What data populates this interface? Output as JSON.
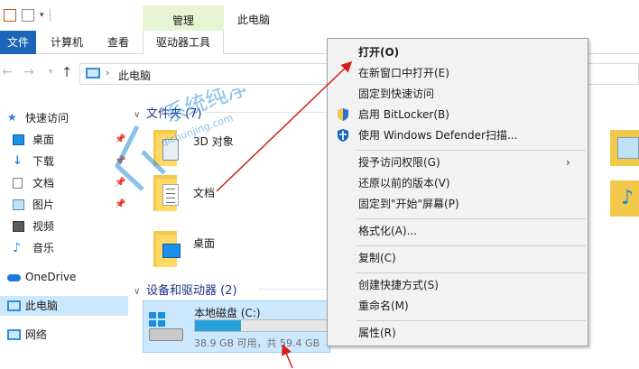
{
  "title_bar": {
    "manage_tab": "管理",
    "window_title": "此电脑"
  },
  "ribbon": {
    "tabs": [
      "文件",
      "计算机",
      "查看",
      "驱动器工具"
    ]
  },
  "address_bar": {
    "separator": "›",
    "path": "此电脑"
  },
  "nav_pane": {
    "quick_access": "快速访问",
    "items": [
      "桌面",
      "下载",
      "文档",
      "图片",
      "视频",
      "音乐"
    ],
    "onedrive": "OneDrive",
    "this_pc": "此电脑",
    "network": "网络"
  },
  "content": {
    "folders_header": "文件夹 (7)",
    "folders": [
      "3D 对象",
      "文档",
      "桌面"
    ],
    "devices_header": "设备和驱动器 (2)",
    "drive": {
      "name": "本地磁盘 (C:)",
      "free_text": "38.9 GB 可用，共 59.4 GB",
      "used_fraction": 0.345
    }
  },
  "watermark": {
    "text": "系统纯净",
    "url": "qichunjing.com"
  },
  "context_menu": {
    "items": [
      {
        "label": "打开(O)"
      },
      {
        "label": "在新窗口中打开(E)"
      },
      {
        "label": "固定到快速访问"
      },
      {
        "label": "启用 BitLocker(B)"
      },
      {
        "label": "使用 Windows Defender扫描..."
      },
      {
        "label": "授予访问权限(G)"
      },
      {
        "label": "还原以前的版本(V)"
      },
      {
        "label": "固定到\"开始\"屏幕(P)"
      },
      {
        "label": "格式化(A)..."
      },
      {
        "label": "复制(C)"
      },
      {
        "label": "创建快捷方式(S)"
      },
      {
        "label": "重命名(M)"
      },
      {
        "label": "属性(R)"
      }
    ]
  },
  "colors": {
    "accent": "#1b65b9",
    "selection": "#cce8ff",
    "annotation_arrow": "#d4201e",
    "manage_band": "#e7f4d4"
  }
}
